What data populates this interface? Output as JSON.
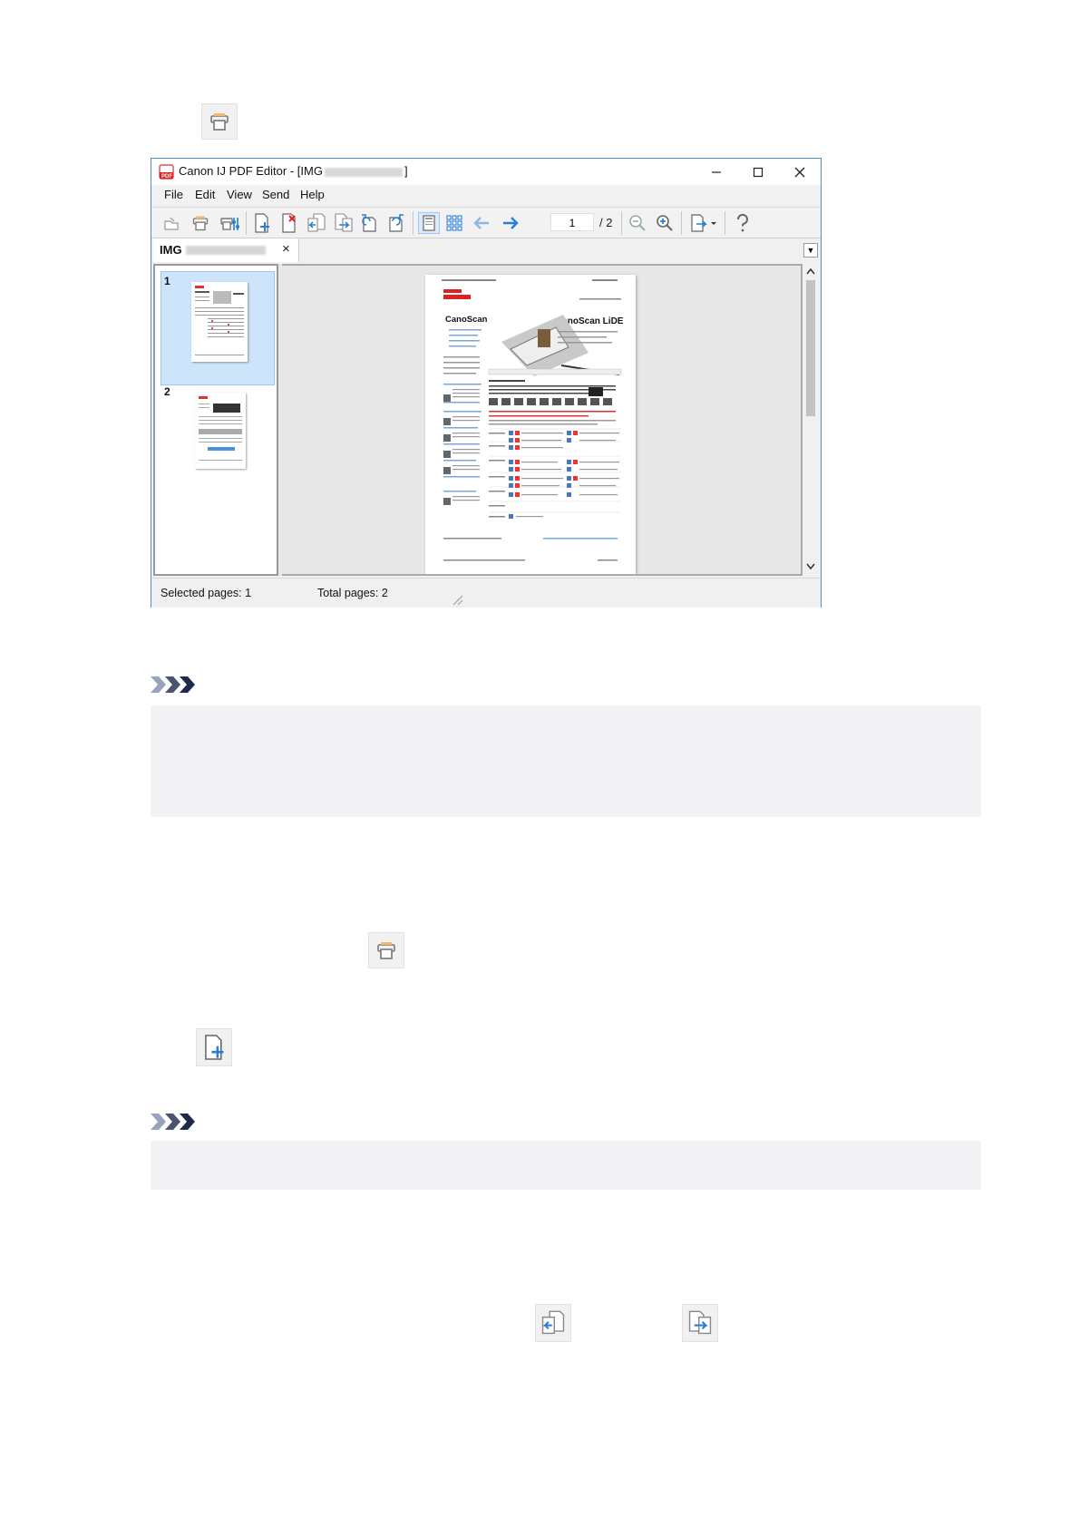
{
  "window": {
    "title_prefix": "Canon IJ PDF Editor - [IMG",
    "title_suffix": "]",
    "menu": [
      "File",
      "Edit",
      "View",
      "Send",
      "Help"
    ],
    "page_field_value": "1",
    "page_total": "/ 2",
    "tab_label": "IMG",
    "tab_close": "×",
    "thumbnails": [
      {
        "number": "1",
        "selected": true
      },
      {
        "number": "2",
        "selected": false
      }
    ],
    "status": {
      "selected": "Selected pages: 1",
      "total": "Total pages: 2"
    }
  },
  "preview_page": {
    "logo": "Canon",
    "title_left": "CanoScan",
    "title_right": "CanoScan LiDE"
  },
  "icons": {
    "scan_icon": "scanner-icon",
    "add_page_icon": "add-page-icon",
    "move_up_icon": "move-page-before-icon",
    "move_down_icon": "move-page-after-icon",
    "note_icon": "note-chevrons-icon"
  },
  "colors": {
    "window_border": "#4a90c8",
    "selection": "#cde4fb",
    "arrow_blue": "#2a7fd4",
    "note_bg": "#f3f3f6",
    "note_chevron": "#1e2a4a"
  }
}
